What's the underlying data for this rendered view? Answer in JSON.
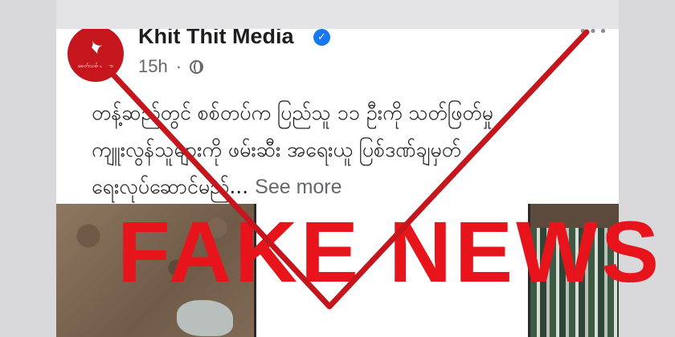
{
  "post": {
    "page_name": "Khit Thit Media",
    "avatar_brand": "ခေတ်သစ် မီဒီယာ",
    "timestamp": "15h",
    "separator": "·",
    "menu": "•••",
    "lines": [
      "တန့်ဆည်တွင် စစ်တပ်က ပြည်သူ ၁၁ ဦးကို သတ်ဖြတ်မှု",
      "ကျူးလွန်သူများကို ဖမ်းဆီး အရေးယူ ပြစ်ဒဏ်ချမှတ်",
      "ရေးလုပ်ဆောင်မည်..."
    ],
    "see_more": "See more"
  },
  "overlay": {
    "stamp_text": "FAKE NEWS",
    "accent_color": "#c4161c",
    "stamp_color": "#e8141b"
  },
  "icons": {
    "verified": "verified-badge-icon",
    "audience": "globe-icon",
    "menu": "more-options-icon"
  }
}
